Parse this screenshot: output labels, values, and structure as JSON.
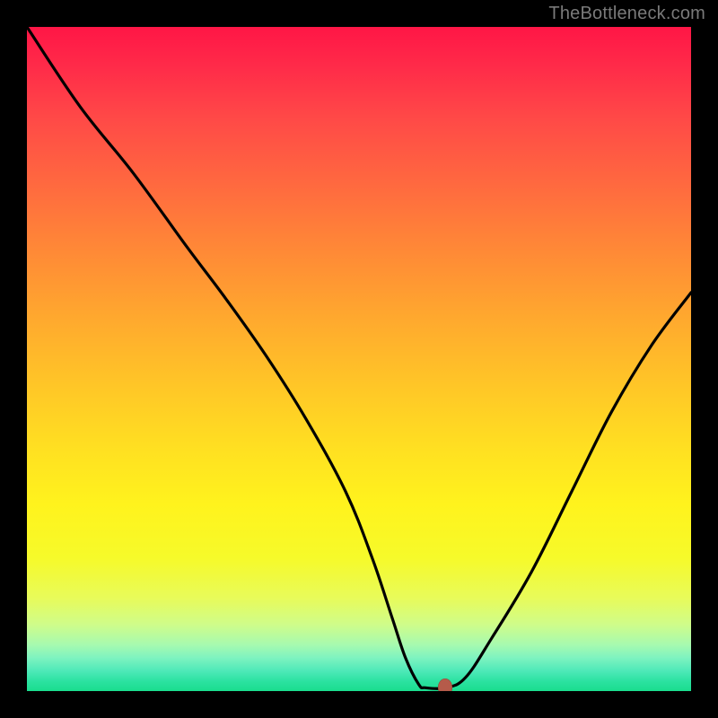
{
  "watermark": "TheBottleneck.com",
  "colors": {
    "page_bg": "#000000",
    "curve_stroke": "#000000",
    "marker_fill": "#b55b4a",
    "watermark_text": "#7a7a7a"
  },
  "chart_data": {
    "type": "line",
    "title": "",
    "xlabel": "",
    "ylabel": "",
    "xlim": [
      0,
      100
    ],
    "ylim": [
      0,
      100
    ],
    "grid": false,
    "legend": false,
    "series": [
      {
        "name": "bottleneck-curve",
        "x": [
          0,
          8,
          16,
          24,
          30,
          36,
          42,
          48,
          52,
          55,
          57,
          59,
          60,
          63,
          66,
          70,
          76,
          82,
          88,
          94,
          100
        ],
        "y": [
          100,
          88,
          78,
          67,
          59,
          50.5,
          41,
          30,
          20,
          11,
          5,
          1,
          0.5,
          0.5,
          2,
          8,
          18,
          30,
          42,
          52,
          60
        ]
      }
    ],
    "marker": {
      "x": 63,
      "y": 0.5
    },
    "background_gradient": {
      "direction": "vertical",
      "stops": [
        {
          "pos": 0.0,
          "color": "#ff1646"
        },
        {
          "pos": 0.24,
          "color": "#ff6a3f"
        },
        {
          "pos": 0.54,
          "color": "#ffc627"
        },
        {
          "pos": 0.8,
          "color": "#f6fa2a"
        },
        {
          "pos": 0.93,
          "color": "#a7faaf"
        },
        {
          "pos": 1.0,
          "color": "#1add8e"
        }
      ]
    }
  }
}
